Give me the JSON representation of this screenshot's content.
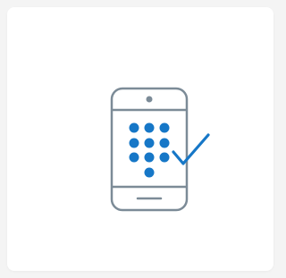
{
  "card": {
    "illustration": {
      "icon": "phone-keypad-check-icon",
      "colors": {
        "phone_outline": "#7c8b97",
        "keypad_dots": "#1677c7",
        "checkmark": "#1677c7",
        "background": "#ffffff",
        "page_background": "#f4f4f4"
      }
    }
  }
}
